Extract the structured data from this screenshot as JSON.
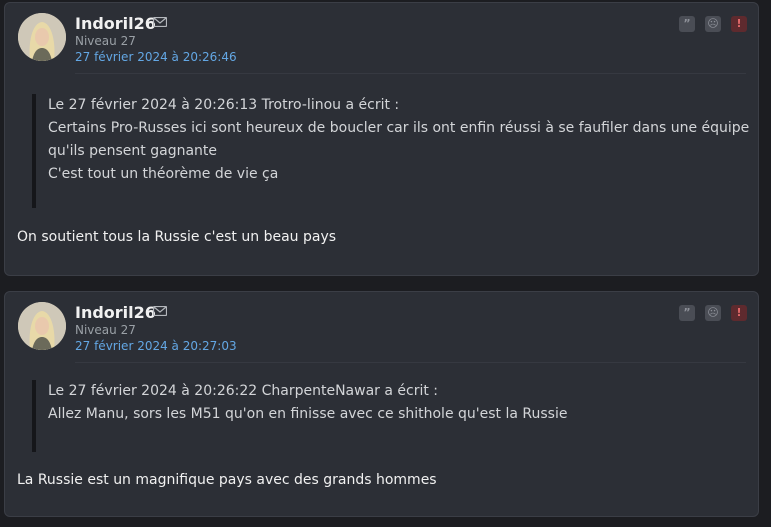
{
  "posts": [
    {
      "username": "Indoril26",
      "level": "Niveau 27",
      "date": "27 février 2024 à 20:26:46",
      "quote": {
        "header": "Le 27 février 2024 à 20:26:13 Trotro-linou a écrit :",
        "lines": [
          "Certains Pro-Russes ici sont heureux de boucler car ils ont enfin réussi à se faufiler dans une équipe",
          "qu'ils pensent gagnante",
          "C'est tout un théorème de vie ça"
        ]
      },
      "message": "On soutient tous la Russie c'est un beau pays"
    },
    {
      "username": "Indoril26",
      "level": "Niveau 27",
      "date": "27 février 2024 à 20:27:03",
      "quote": {
        "header": "Le 27 février 2024 à 20:26:22 CharpenteNawar a écrit :",
        "lines": [
          "Allez Manu, sors les M51 qu'on en finisse avec ce shithole qu'est la Russie"
        ]
      },
      "message": "La Russie est un magnifique pays avec des grands hommes"
    }
  ],
  "actions": {
    "quote_glyph": "”",
    "sad_glyph": "☹",
    "report_glyph": "!"
  },
  "icons": [
    "avatar",
    "mail-icon",
    "quote-icon",
    "sad-icon",
    "report-icon"
  ],
  "colors": {
    "background": "#1c1d21",
    "card": "#2c2f36",
    "date_link": "#63a7e4",
    "report": "#e26a6a"
  }
}
